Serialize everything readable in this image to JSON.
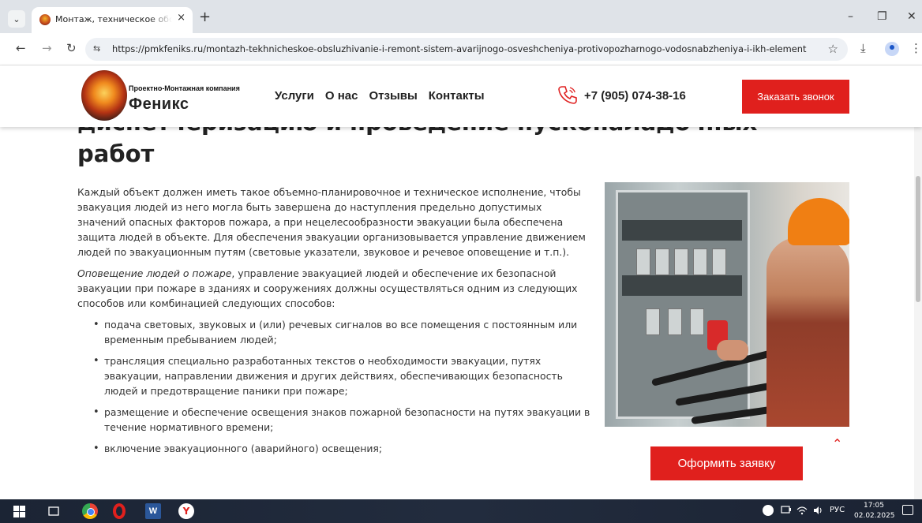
{
  "browser": {
    "tab_title": "Монтаж, техническое обслуживание",
    "tab_close": "×",
    "new_tab": "+",
    "url": "https://pmkfeniks.ru/montazh-tekhnicheskoe-obsluzhivanie-i-remont-sistem-avarijnogo-osveshcheniya-protivopozharnogo-vodosnabzheniya-i-ikh-elementov-vklyuch...",
    "back": "←",
    "forward": "→",
    "reload": "↻",
    "site_info": "⇆",
    "bookmark": "☆",
    "download": "⤓",
    "menu": "⋮",
    "minimize": "–",
    "restore": "❐",
    "close": "✕",
    "tab_menu": "⌄"
  },
  "header": {
    "logo_subtitle": "Проектно-Монтажная компания",
    "logo_title": "Феникс",
    "nav": [
      "Услуги",
      "О нас",
      "Отзывы",
      "Контакты"
    ],
    "phone": "+7 (905) 074-38-16",
    "callback_button": "Заказать звонок"
  },
  "content": {
    "heading_top": "диспетчеризацию и проведение пусконаладочных",
    "heading_bottom": "работ",
    "paragraph1": "Каждый объект должен иметь такое объемно-планировочное и техническое исполнение, чтобы эвакуация людей из него могла быть завершена до наступления предельно допустимых значений опасных факторов пожара, а при нецелесообразности эвакуации была обеспечена защита людей в объекте. Для обеспечения эвакуации организовывается управление движением людей по эвакуационным путям (световые указатели, звуковое и речевое оповещение и т.п.).",
    "paragraph2_em": "Оповещение людей о пожаре",
    "paragraph2_rest": ", управление эвакуацией людей и обеспечение их безопасной эвакуации при пожаре в зданиях и сооружениях должны осуществляться одним из следующих способов или комбинацией следующих способов:",
    "list": [
      "подача световых, звуковых и (или) речевых сигналов во все помещения с постоянным или временным пребыванием людей;",
      "трансляция специально разработанных текстов о необходимости эвакуации, путях эвакуации, направлении движения и других действиях, обеспечивающих безопасность людей и предотвращение паники при пожаре;",
      "размещение и обеспечение освещения знаков пожарной безопасности на путях эвакуации в течение нормативного времени;",
      "включение эвакуационного (аварийного) освещения;"
    ],
    "order_button": "Оформить заявку",
    "scroll_up": "⌃"
  },
  "taskbar": {
    "word_label": "W",
    "yandex_label": "Y",
    "lang": "РУС",
    "time": "17:05",
    "date": "02.02.2025"
  },
  "colors": {
    "accent": "#e0201d",
    "taskbar": "#1e2738"
  }
}
